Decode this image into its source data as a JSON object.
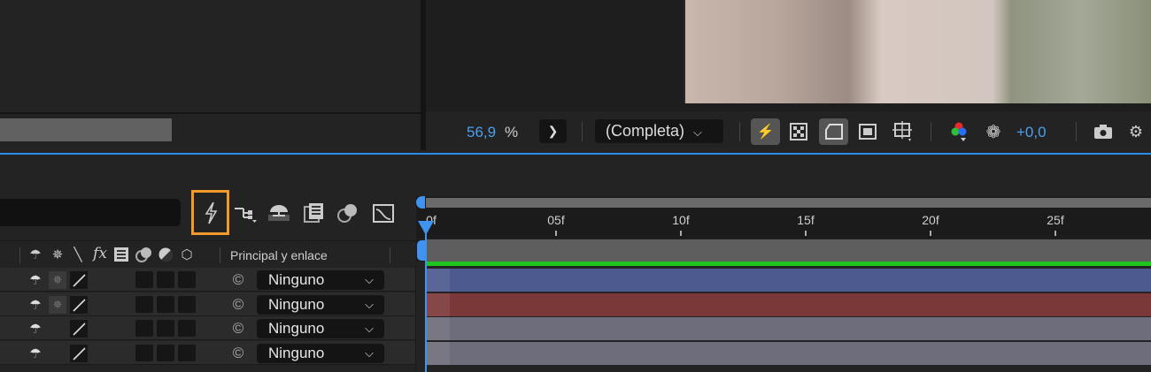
{
  "viewer": {
    "zoom_value": "56,9",
    "zoom_unit": "%",
    "resolution": "(Completa)",
    "exposure": "+0,0"
  },
  "timeline": {
    "parent_header": "Principal y enlace",
    "ruler": [
      "0f",
      "05f",
      "10f",
      "15f",
      "20f",
      "25f"
    ],
    "layers": [
      {
        "parent": "Ninguno",
        "color": "#4c5a8f",
        "has_sun": true
      },
      {
        "parent": "Ninguno",
        "color": "#7b3838",
        "has_sun": true
      },
      {
        "parent": "Ninguno",
        "color": "#6d6d7b",
        "has_sun": false
      },
      {
        "parent": "Ninguno",
        "color": "#6d6d7b",
        "has_sun": false
      }
    ]
  },
  "colors": {
    "accent": "#2d8ceb",
    "highlight": "#f29a2a",
    "workarea": "#1fc51f"
  }
}
